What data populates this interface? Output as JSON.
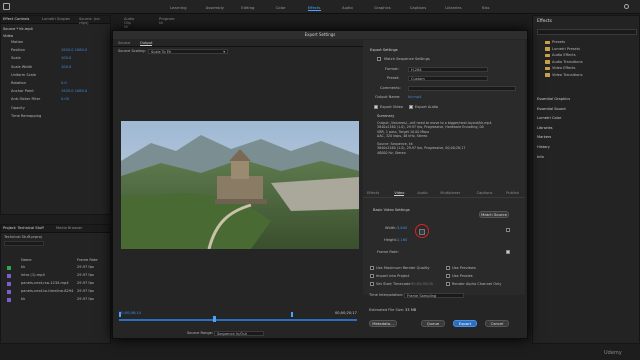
{
  "workspaces": [
    "Learning",
    "Assembly",
    "Editing",
    "Color",
    "Effects",
    "Audio",
    "Graphics",
    "Captions",
    "Libraries",
    "Kiss"
  ],
  "active_workspace": "Effects",
  "source_tabs": [
    "Effect Controls",
    "Lumetri Scopes",
    "Source: (no clips)",
    "Audio Clip Mi",
    "Program: kk"
  ],
  "effect_controls": {
    "source_label": "Source * kk.mp4",
    "video_label": "Video",
    "rows": [
      {
        "label": "Motion",
        "value": ""
      },
      {
        "label": "Position",
        "value": "1920.0   1080.0"
      },
      {
        "label": "Scale",
        "value": "100.0"
      },
      {
        "label": "Scale Width",
        "value": "100.0"
      },
      {
        "label": "Uniform Scale",
        "value": ""
      },
      {
        "label": "Rotation",
        "value": "0.0"
      },
      {
        "label": "Anchor Point",
        "value": "1920.0   1080.0"
      },
      {
        "label": "Anti-flicker Filter",
        "value": "0.00"
      },
      {
        "label": "Opacity",
        "value": ""
      },
      {
        "label": "Time Remapping",
        "value": ""
      }
    ]
  },
  "project": {
    "tabs": [
      "Project: Technical Stuff",
      "Media Browser"
    ],
    "path": "Technical Stuff.prproj",
    "col_name": "Name",
    "col_rate": "Frame Rate",
    "items": [
      {
        "name": "kk",
        "rate": "29.97 fps",
        "color": "#2fa84a"
      },
      {
        "name": "intro (1).mp4",
        "rate": "29.97 fps",
        "color": "#7a5fd1"
      },
      {
        "name": "panels-next-rsa-1234.mp4",
        "rate": "29.97 fps",
        "color": "#7a5fd1"
      },
      {
        "name": "panels-next-to-timeline-8294",
        "rate": "29.97 fps",
        "color": "#7a5fd1"
      },
      {
        "name": "kk",
        "rate": "29.97 fps",
        "color": "#7a5fd1"
      }
    ]
  },
  "effects_panel": {
    "title": "Effects",
    "folders": [
      "Presets",
      "Lumetri Presets",
      "Audio Effects",
      "Audio Transitions",
      "Video Effects",
      "Video Transitions"
    ],
    "sections": [
      "Essential Graphics",
      "Essential Sound",
      "Lumetri Color",
      "Libraries",
      "Markers",
      "History",
      "Info"
    ]
  },
  "dialog": {
    "title": "Export Settings",
    "preview_tabs": [
      "Source",
      "Output"
    ],
    "source_scaling_label": "Source Scaling:",
    "source_scaling_value": "Scale To Fit",
    "timecode_in": "00;00;08;14",
    "timecode_out": "00;00;20;17",
    "source_range_label": "Source Range:",
    "source_range_value": "Sequence In/Out",
    "export_header": "Export Settings",
    "match_sequence": "Match Sequence Settings",
    "format_label": "Format:",
    "format_value": "H.264",
    "preset_label": "Preset:",
    "preset_value": "Custom",
    "comments_label": "Comments:",
    "output_name_label": "Output Name:",
    "output_name_value": "kk.mp4",
    "export_video": "Export Video",
    "export_audio": "Export Audio",
    "summary_label": "Summary",
    "summary_output": "Output: /Volumes/...will need to move to a bigger/next-layout/kk.mp4\n3840x2160 (1.0), 29.97 fps, Progressive, Hardware Encoding, 00\nVBR, 1 pass, Target 10.00 Mbps\nAAC, 320 kbps, 48 kHz, Stereo",
    "summary_source": "Source: Sequence, kk\n3840x2160 (1.0), 29.97 fps, Progressive, 00;00;28;17\n48000 Hz, Stereo",
    "settings_tabs": [
      "Effects",
      "Video",
      "Audio",
      "Multiplexer",
      "Captions",
      "Publish"
    ],
    "active_settings_tab": "Video",
    "basic_video_header": "Basic Video Settings",
    "match_source_btn": "Match Source",
    "width_label": "Width:",
    "width_value": "3,840",
    "height_label": "Height:",
    "height_value": "2,160",
    "frame_rate_label": "Frame Rate:",
    "opt_max_render": "Use Maximum Render Quality",
    "opt_use_previews": "Use Previews",
    "opt_import_project": "Import into Project",
    "opt_use_proxies": "Use Proxies",
    "opt_set_start": "Set Start Timecode",
    "opt_set_start_value": "00;00;00;00",
    "opt_render_alpha": "Render Alpha Channel Only",
    "time_interp_label": "Time Interpolation:",
    "time_interp_value": "Frame Sampling",
    "file_size_label": "Estimated File Size:",
    "file_size_value": "33 MB",
    "btn_metadata": "Metadata...",
    "btn_queue": "Queue",
    "btn_export": "Export",
    "btn_cancel": "Cancel"
  },
  "watermark": "Udemy",
  "colors": {
    "accent": "#3f8fe3",
    "highlight_circle": "#d2232a",
    "primary_button": "#2d6fbf"
  }
}
